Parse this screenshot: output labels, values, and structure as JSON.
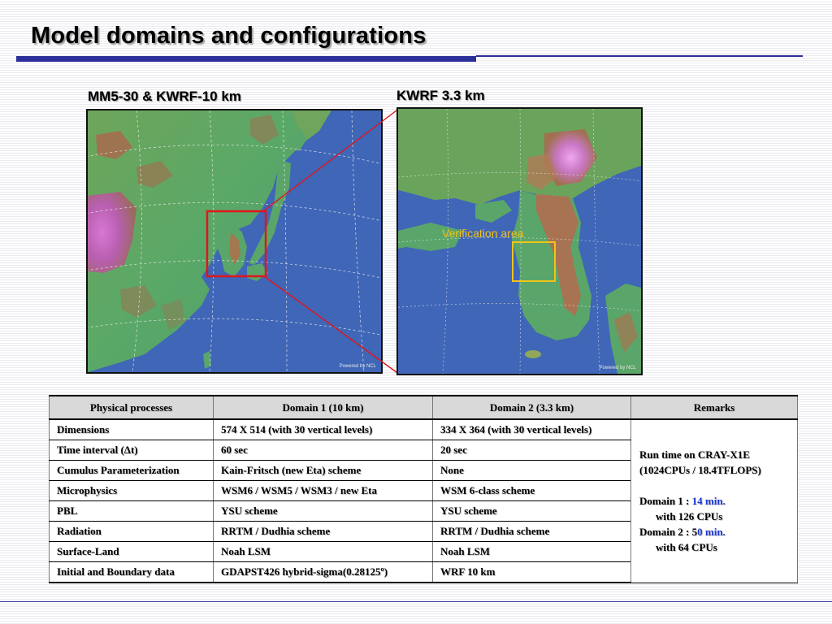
{
  "slide": {
    "title": "Model domains and configurations"
  },
  "maps": {
    "left_label": "MM5-30 & KWRF-10 km",
    "right_label": "KWRF 3.3 km",
    "verification_label": "Verification area",
    "credit_left": "Powered by NCL",
    "credit_right": "Powered by NCL",
    "colors": {
      "ocean": "#3f66b7",
      "lowland": "#4fa06a",
      "highland": "#b06a4a",
      "peak": "#d46fd0",
      "domain_box": "#e0161c",
      "verification_box": "#f0c419"
    }
  },
  "table": {
    "headers": [
      "Physical processes",
      "Domain 1 (10 km)",
      "Domain 2 (3.3 km)",
      "Remarks"
    ],
    "rows": [
      [
        "Dimensions",
        "574 X 514 (with 30 vertical levels)",
        "334 X 364 (with 30 vertical levels)"
      ],
      [
        "Time interval (Δt)",
        "60 sec",
        "20 sec"
      ],
      [
        "Cumulus Parameterization",
        "Kain-Fritsch (new Eta) scheme",
        "None"
      ],
      [
        "Microphysics",
        "WSM6 / WSM5 / WSM3 / new Eta",
        "WSM 6-class scheme"
      ],
      [
        "PBL",
        "YSU scheme",
        "YSU scheme"
      ],
      [
        "Radiation",
        "RRTM / Dudhia scheme",
        "RRTM / Dudhia scheme"
      ],
      [
        "Surface-Land",
        "Noah LSM",
        "Noah LSM"
      ],
      [
        "Initial and Boundary data",
        "GDAPST426 hybrid-sigma(0.28125º)",
        "WRF 10 km"
      ]
    ],
    "remarks": {
      "line1": "Run time on CRAY-X1E",
      "line2": "(1024CPUs / 18.4TFLOPS)",
      "d1_prefix": "Domain 1 : ",
      "d1_time": "14 min.",
      "d1_cpus": "with 126 CPUs",
      "d2_prefix": "Domain 2 : 5",
      "d2_time": "0 min.",
      "d2_cpus": "with 64 CPUs"
    }
  }
}
